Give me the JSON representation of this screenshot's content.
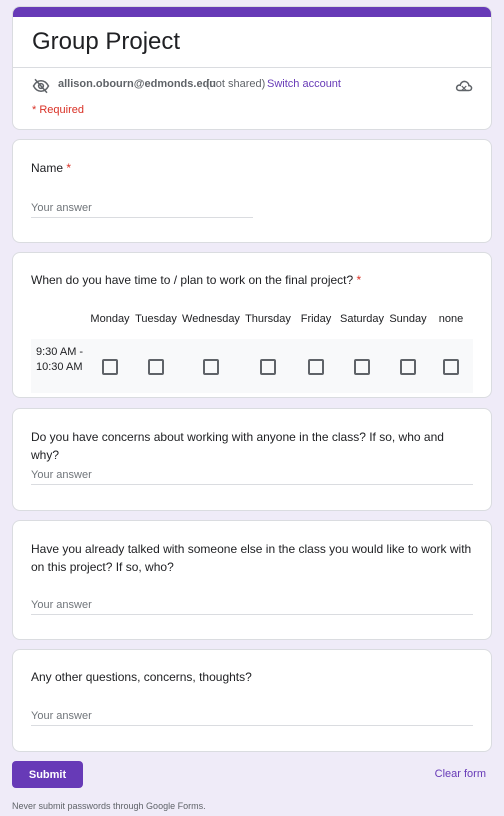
{
  "header": {
    "title": "Group Project",
    "accent_color": "#673ab7",
    "account_email": "allison.obourn@edmonds.edu",
    "not_shared": "(not shared)",
    "switch_account": "Switch account",
    "required_note": "* Required",
    "icons": [
      "eye-off-icon",
      "cloud-off-icon"
    ]
  },
  "questions": {
    "name": {
      "title": "Name",
      "required_mark": "*",
      "placeholder": "Your answer"
    },
    "time": {
      "title": "When do you have time to / plan to work on the final project?",
      "required_mark": "*",
      "columns": [
        "Monday",
        "Tuesday",
        "Wednesday",
        "Thursday",
        "Friday",
        "Saturday",
        "Sunday",
        "none"
      ],
      "rows": [
        {
          "label": "9:30 AM - 10:30 AM",
          "checked": [
            false,
            false,
            false,
            false,
            false,
            false,
            false,
            false
          ]
        }
      ]
    },
    "concerns": {
      "title": "Do you have concerns about working with anyone in the class? If so, who and why?",
      "placeholder": "Your answer"
    },
    "talked": {
      "title": "Have you already talked with someone else in the class you would like to work with on this project? If so, who?",
      "placeholder": "Your answer"
    },
    "other": {
      "title": "Any other questions, concerns, thoughts?",
      "placeholder": "Your answer"
    }
  },
  "actions": {
    "submit": "Submit",
    "clear": "Clear form"
  },
  "footer": {
    "note": "Never submit passwords through Google Forms."
  }
}
